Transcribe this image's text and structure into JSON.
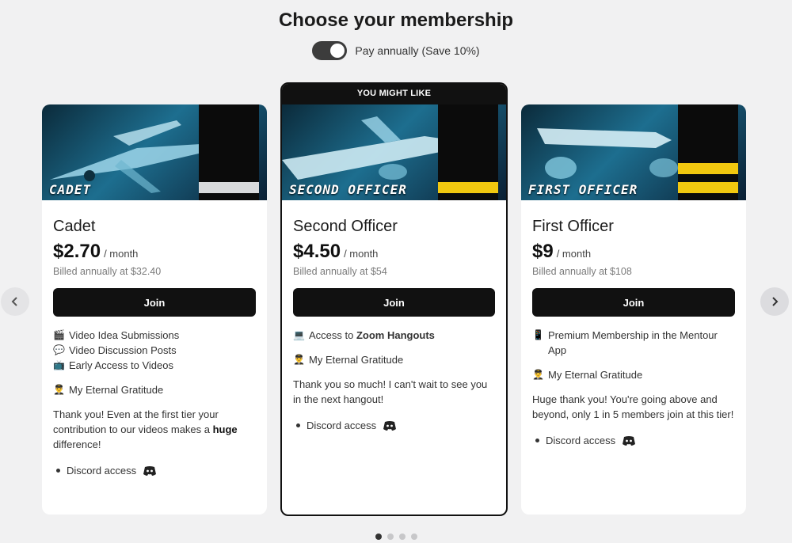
{
  "header": {
    "title": "Choose your membership",
    "toggle_label": "Pay annually (Save 10%)",
    "toggle_on": true
  },
  "tiers": [
    {
      "rank_label": "CADET",
      "name": "Cadet",
      "price": "$2.70",
      "per": "/ month",
      "billed": "Billed annually at $32.40",
      "join_label": "Join",
      "features": [
        {
          "icon": "clapper-icon",
          "text": "Video Idea Submissions"
        },
        {
          "icon": "speech-bubble-icon",
          "text": "Video Discussion Posts"
        },
        {
          "icon": "tv-icon",
          "text": "Early Access to Videos"
        }
      ],
      "gratitude": "My Eternal Gratitude",
      "message_pre": "Thank you! Even at the first tier your contribution to our videos makes a ",
      "message_bold": "huge",
      "message_post": " difference!",
      "perk": "Discord access",
      "stripe_color": "#d9dadc"
    },
    {
      "badge": "YOU MIGHT LIKE",
      "rank_label": "SECOND OFFICER",
      "name": "Second Officer",
      "price": "$4.50",
      "per": "/ month",
      "billed": "Billed annually at $54",
      "join_label": "Join",
      "feature_pre": "Access to ",
      "feature_bold": "Zoom Hangouts",
      "gratitude": "My Eternal Gratitude",
      "message": "Thank you so much! I can't wait to see you in the next hangout!",
      "perk": "Discord access",
      "stripe_color": "#f2c80f"
    },
    {
      "rank_label": "FIRST OFFICER",
      "name": "First Officer",
      "price": "$9",
      "per": "/ month",
      "billed": "Billed annually at $108",
      "join_label": "Join",
      "feature": "Premium Membership in the Mentour App",
      "gratitude": "My Eternal Gratitude",
      "message": "Huge thank you! You're going above and beyond, only 1 in 5 members join at this tier!",
      "perk": "Discord access",
      "stripe_color": "#f2c80f"
    }
  ],
  "carousel": {
    "prev_icon": "chevron-left-icon",
    "next_icon": "chevron-right-icon",
    "page_count": 4,
    "active_page": 1
  }
}
